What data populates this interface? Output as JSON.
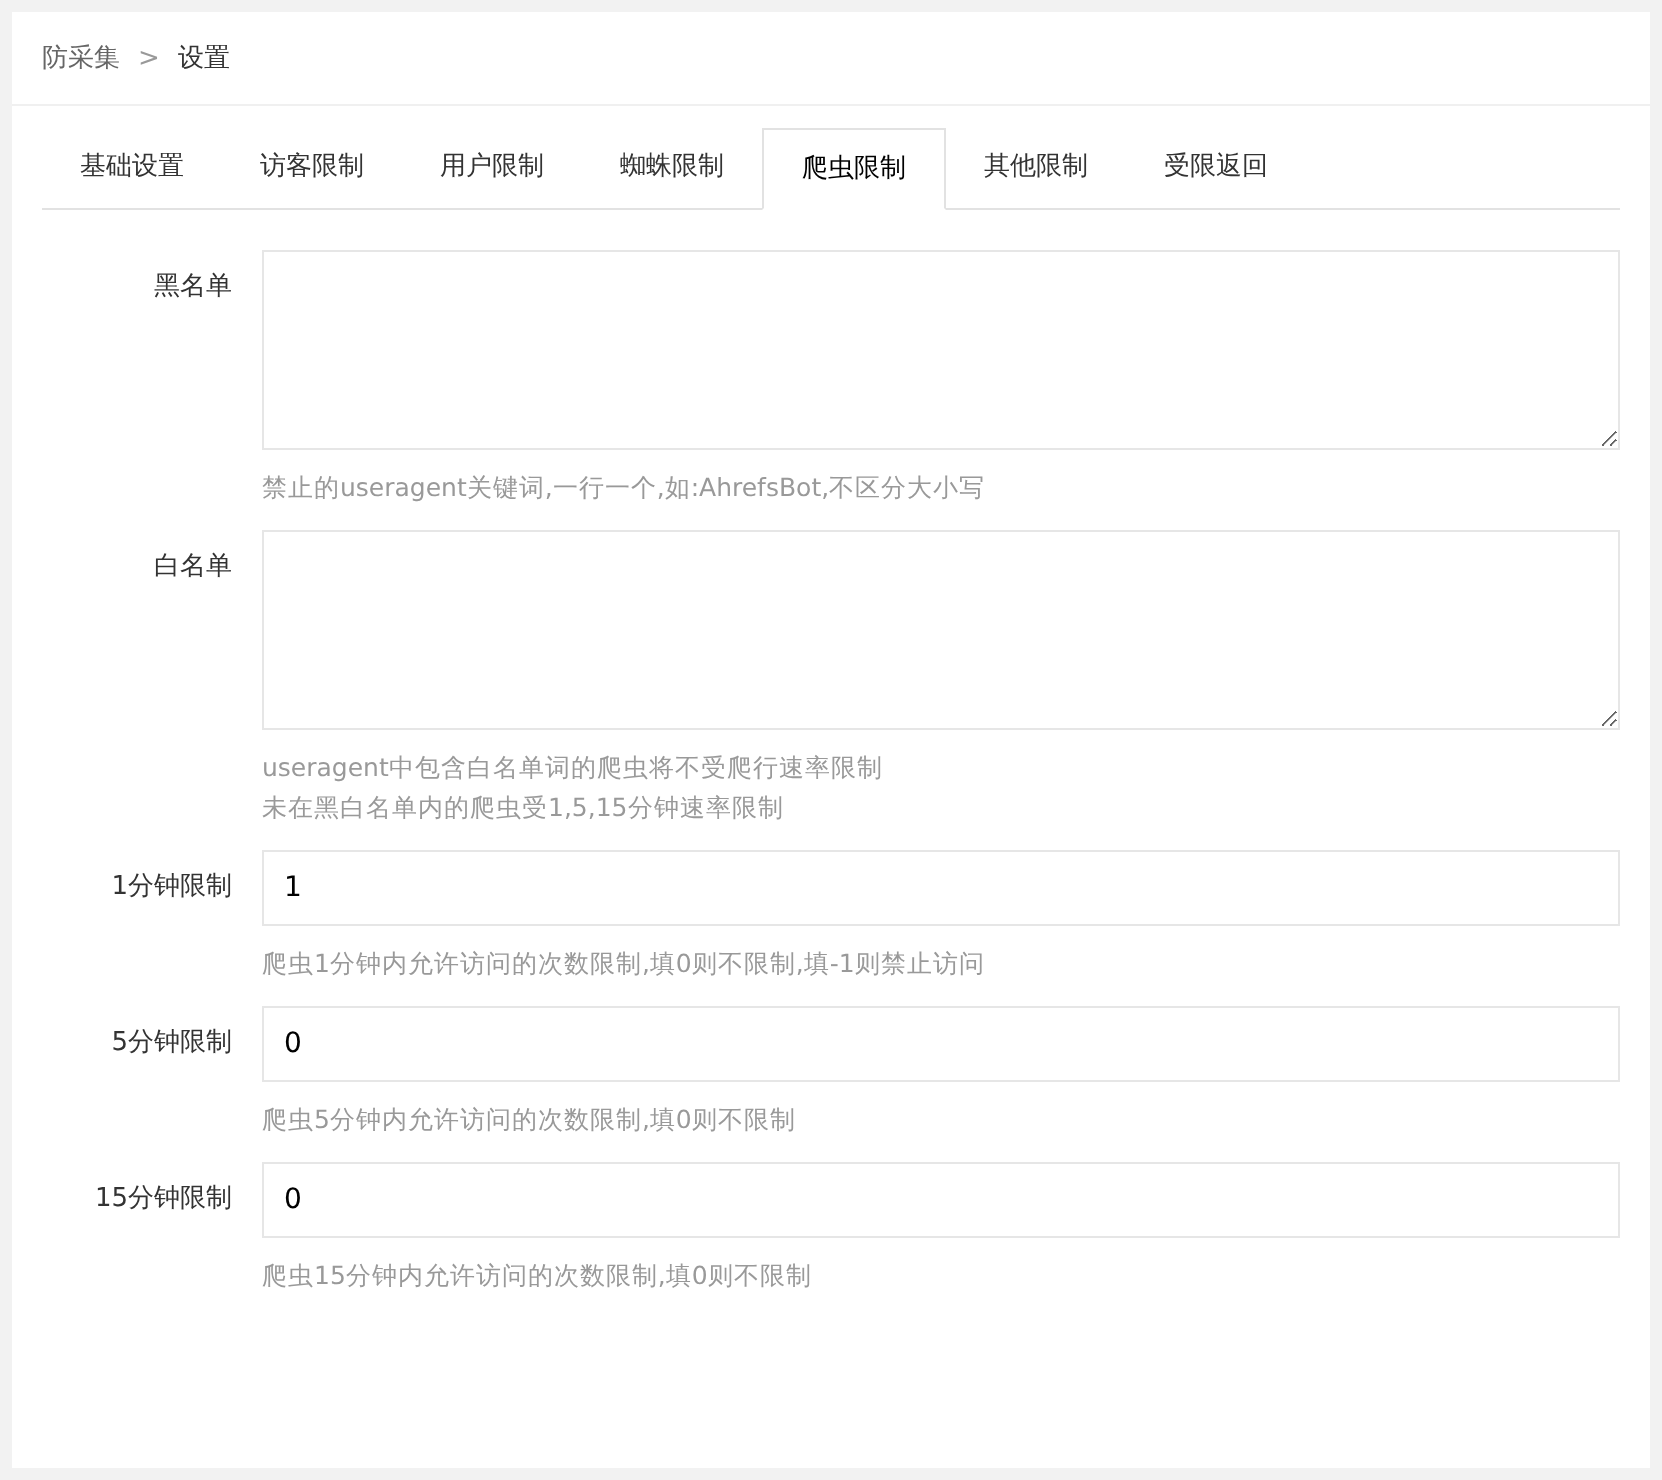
{
  "breadcrumb": {
    "items": [
      "防采集",
      "设置"
    ],
    "separator": ">"
  },
  "tabs": [
    {
      "label": "基础设置",
      "selected": false
    },
    {
      "label": "访客限制",
      "selected": false
    },
    {
      "label": "用户限制",
      "selected": false
    },
    {
      "label": "蜘蛛限制",
      "selected": false
    },
    {
      "label": "爬虫限制",
      "selected": true
    },
    {
      "label": "其他限制",
      "selected": false
    },
    {
      "label": "受限返回",
      "selected": false
    }
  ],
  "fields": [
    {
      "kind": "textarea",
      "label": "黑名单",
      "help": [
        "禁止的useragent关键词,一行一个,如:AhrefsBot,不区分大小写"
      ]
    },
    {
      "kind": "textarea",
      "label": "白名单",
      "help": [
        "useragent中包含白名单词的爬虫将不受爬行速率限制",
        "未在黑白名单内的爬虫受1,5,15分钟速率限制"
      ]
    },
    {
      "kind": "input",
      "label": "1分钟限制",
      "value": "1",
      "help": [
        "爬虫1分钟内允许访问的次数限制,填0则不限制,填-1则禁止访问"
      ]
    },
    {
      "kind": "input",
      "label": "5分钟限制",
      "value": "0",
      "help": [
        "爬虫5分钟内允许访问的次数限制,填0则不限制"
      ]
    },
    {
      "kind": "input",
      "label": "15分钟限制",
      "value": "0",
      "help": [
        "爬虫15分钟内允许访问的次数限制,填0则不限制"
      ]
    }
  ]
}
